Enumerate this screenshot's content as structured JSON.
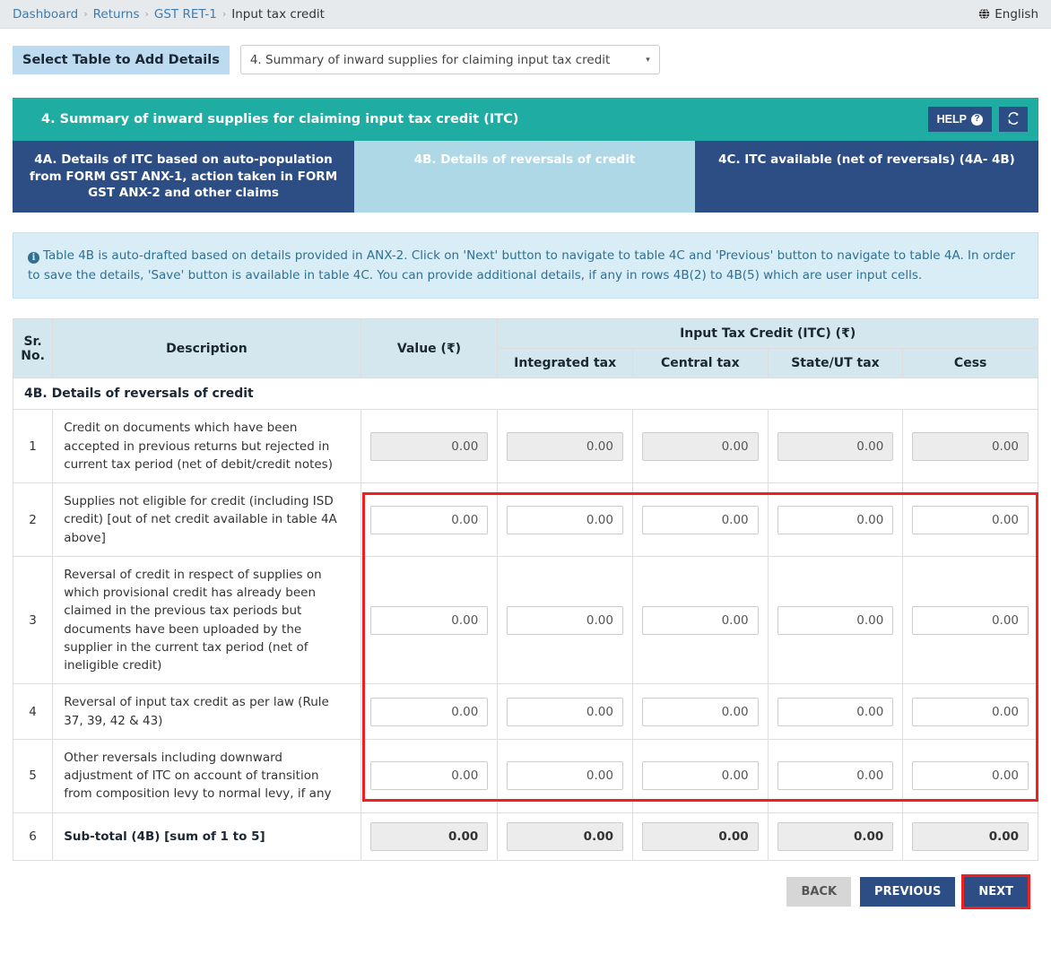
{
  "breadcrumb": {
    "items": [
      "Dashboard",
      "Returns",
      "GST RET-1",
      "Input tax credit"
    ],
    "separator": "›"
  },
  "language": {
    "label": "English",
    "icon": "globe-icon"
  },
  "select_table": {
    "label": "Select Table to Add Details",
    "selected": "4. Summary of inward supplies for claiming input tax credit",
    "caret": "▾"
  },
  "panel": {
    "title": "4. Summary of inward supplies for claiming input tax credit (ITC)",
    "help_label": "HELP",
    "help_icon": "question-circle-icon",
    "refresh_icon": "↻",
    "accent_teal": "#1fada3",
    "accent_navy": "#2c4e85",
    "accent_active_tab": "#afd8e6"
  },
  "tabs": [
    {
      "id": "4A",
      "label": "4A. Details of ITC based on auto-population from FORM GST ANX-1, action taken in FORM GST ANX-2 and other claims",
      "active": false
    },
    {
      "id": "4B",
      "label": "4B. Details of reversals of credit",
      "active": true
    },
    {
      "id": "4C",
      "label": "4C. ITC available (net of reversals) (4A- 4B)",
      "active": false
    }
  ],
  "alert": {
    "text": "Table 4B is auto-drafted based on details provided in ANX-2. Click on 'Next' button to navigate to table 4C and 'Previous' button to navigate to table 4A. In order to save the details, 'Save' button is available in table 4C. You can provide additional details, if any in rows 4B(2) to 4B(5) which are user input cells.",
    "icon": "info-icon"
  },
  "table": {
    "headers": {
      "sr": "Sr. No.",
      "sr_line1": "Sr.",
      "sr_line2": "No.",
      "description": "Description",
      "value": "Value (₹)",
      "itc_group": "Input Tax Credit (ITC) (₹)",
      "integrated": "Integrated tax",
      "central": "Central tax",
      "state": "State/UT tax",
      "cess": "Cess"
    },
    "section_title": "4B. Details of reversals of credit",
    "rows": [
      {
        "sr": "1",
        "description": "Credit on documents which have been accepted in previous returns but rejected in current tax period (net of debit/credit notes)",
        "editable": false,
        "bold": false,
        "values": [
          "0.00",
          "0.00",
          "0.00",
          "0.00",
          "0.00"
        ]
      },
      {
        "sr": "2",
        "description": "Supplies not eligible for credit (including ISD credit) [out of net credit available in table 4A above]",
        "editable": true,
        "bold": false,
        "values": [
          "0.00",
          "0.00",
          "0.00",
          "0.00",
          "0.00"
        ]
      },
      {
        "sr": "3",
        "description": "Reversal of credit in respect of supplies on which provisional credit has already been claimed in the previous tax periods but documents have been uploaded by the supplier in the current tax period (net of ineligible credit)",
        "editable": true,
        "bold": false,
        "values": [
          "0.00",
          "0.00",
          "0.00",
          "0.00",
          "0.00"
        ]
      },
      {
        "sr": "4",
        "description": "Reversal of input tax credit as per law (Rule 37, 39, 42 & 43)",
        "editable": true,
        "bold": false,
        "values": [
          "0.00",
          "0.00",
          "0.00",
          "0.00",
          "0.00"
        ]
      },
      {
        "sr": "5",
        "description": "Other reversals including downward adjustment of ITC on account of transition from composition levy to normal levy, if any",
        "editable": true,
        "bold": false,
        "values": [
          "0.00",
          "0.00",
          "0.00",
          "0.00",
          "0.00"
        ]
      },
      {
        "sr": "6",
        "description": "Sub-total (4B) [sum of 1 to 5]",
        "editable": false,
        "bold": true,
        "total": true,
        "values": [
          "0.00",
          "0.00",
          "0.00",
          "0.00",
          "0.00"
        ]
      }
    ]
  },
  "footer": {
    "back": "BACK",
    "previous": "PREVIOUS",
    "next": "NEXT",
    "highlight_color": "#ef2020"
  }
}
